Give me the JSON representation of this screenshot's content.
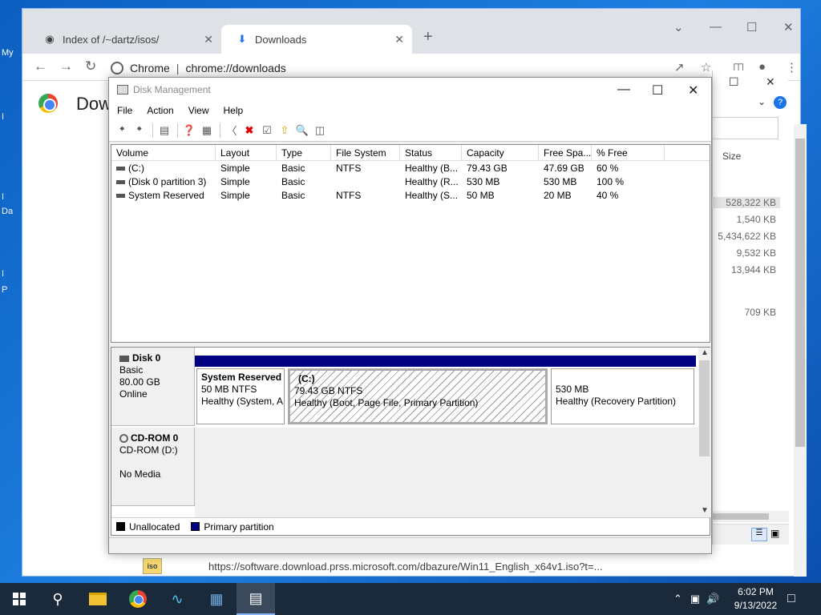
{
  "desktop": {
    "labels": [
      "My",
      "I",
      "I",
      "Da",
      "I",
      "P"
    ]
  },
  "chrome": {
    "tabs": [
      {
        "title": "Index of /~dartz/isos/",
        "icon": "tab-favicon-icon"
      },
      {
        "title": "Downloads",
        "icon": "download-icon"
      }
    ],
    "omnibox": {
      "site": "Chrome",
      "url": "chrome://downloads"
    },
    "page_title": "Dow",
    "download_bar": {
      "badge": "iso",
      "url": "https://software.download.prss.microsoft.com/dbazure/Win11_English_x64v1.iso?t=..."
    }
  },
  "downloads_panel": {
    "size_header": "Size",
    "sizes": [
      "528,322 KB",
      "1,540 KB",
      "5,434,622 KB",
      "9,532 KB",
      "13,944 KB",
      "709 KB"
    ]
  },
  "disk_mgmt": {
    "title": "Disk Management",
    "menu": [
      "File",
      "Action",
      "View",
      "Help"
    ],
    "columns": [
      "Volume",
      "Layout",
      "Type",
      "File System",
      "Status",
      "Capacity",
      "Free Spa...",
      "% Free"
    ],
    "volumes": [
      {
        "volume": "(C:)",
        "layout": "Simple",
        "type": "Basic",
        "fs": "NTFS",
        "status": "Healthy (B...",
        "capacity": "79.43 GB",
        "free": "47.69 GB",
        "pct": "60 %"
      },
      {
        "volume": "(Disk 0 partition 3)",
        "layout": "Simple",
        "type": "Basic",
        "fs": "",
        "status": "Healthy (R...",
        "capacity": "530 MB",
        "free": "530 MB",
        "pct": "100 %"
      },
      {
        "volume": "System Reserved",
        "layout": "Simple",
        "type": "Basic",
        "fs": "NTFS",
        "status": "Healthy (S...",
        "capacity": "50 MB",
        "free": "20 MB",
        "pct": "40 %"
      }
    ],
    "disk0": {
      "name": "Disk 0",
      "type": "Basic",
      "size": "80.00 GB",
      "state": "Online",
      "partitions": [
        {
          "title": "System Reserved",
          "line1": "50 MB NTFS",
          "line2": "Healthy (System, A"
        },
        {
          "title": "(C:)",
          "line1": "79.43 GB NTFS",
          "line2": "Healthy (Boot, Page File, Primary Partition)"
        },
        {
          "title": "",
          "line1": "530 MB",
          "line2": "Healthy (Recovery Partition)"
        }
      ]
    },
    "cdrom": {
      "name": "CD-ROM 0",
      "type": "CD-ROM (D:)",
      "media": "No Media"
    },
    "legend": [
      {
        "label": "Unallocated",
        "color": "#000000"
      },
      {
        "label": "Primary partition",
        "color": "#000080"
      }
    ]
  },
  "taskbar": {
    "time": "6:02 PM",
    "date": "9/13/2022"
  },
  "colors": {
    "partition_bar": "#000080",
    "accent": "#1a73e8"
  }
}
